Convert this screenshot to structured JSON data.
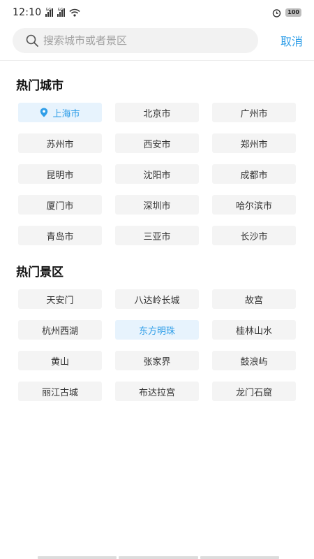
{
  "status_bar": {
    "time": "12:10",
    "signal1_label": "5G",
    "signal2_label": "5G",
    "battery": "100"
  },
  "search": {
    "placeholder": "搜索城市或者景区",
    "value": "",
    "cancel_label": "取消"
  },
  "hot_cities": {
    "title": "热门城市",
    "items": [
      {
        "label": "上海市",
        "active": true
      },
      {
        "label": "北京市"
      },
      {
        "label": "广州市"
      },
      {
        "label": "苏州市"
      },
      {
        "label": "西安市"
      },
      {
        "label": "郑州市"
      },
      {
        "label": "昆明市"
      },
      {
        "label": "沈阳市"
      },
      {
        "label": "成都市"
      },
      {
        "label": "厦门市"
      },
      {
        "label": "深圳市"
      },
      {
        "label": "哈尔滨市"
      },
      {
        "label": "青岛市"
      },
      {
        "label": "三亚市"
      },
      {
        "label": "长沙市"
      }
    ]
  },
  "hot_scenic": {
    "title": "热门景区",
    "items": [
      {
        "label": "天安门"
      },
      {
        "label": "八达岭长城"
      },
      {
        "label": "故宫"
      },
      {
        "label": "杭州西湖"
      },
      {
        "label": "东方明珠",
        "active": true
      },
      {
        "label": "桂林山水"
      },
      {
        "label": "黄山"
      },
      {
        "label": "张家界"
      },
      {
        "label": "鼓浪屿"
      },
      {
        "label": "丽江古城"
      },
      {
        "label": "布达拉宫"
      },
      {
        "label": "龙门石窟"
      }
    ]
  },
  "colors": {
    "accent": "#2f9ee8",
    "chip_bg": "#f4f4f4",
    "chip_active_bg": "#e7f3fd"
  }
}
